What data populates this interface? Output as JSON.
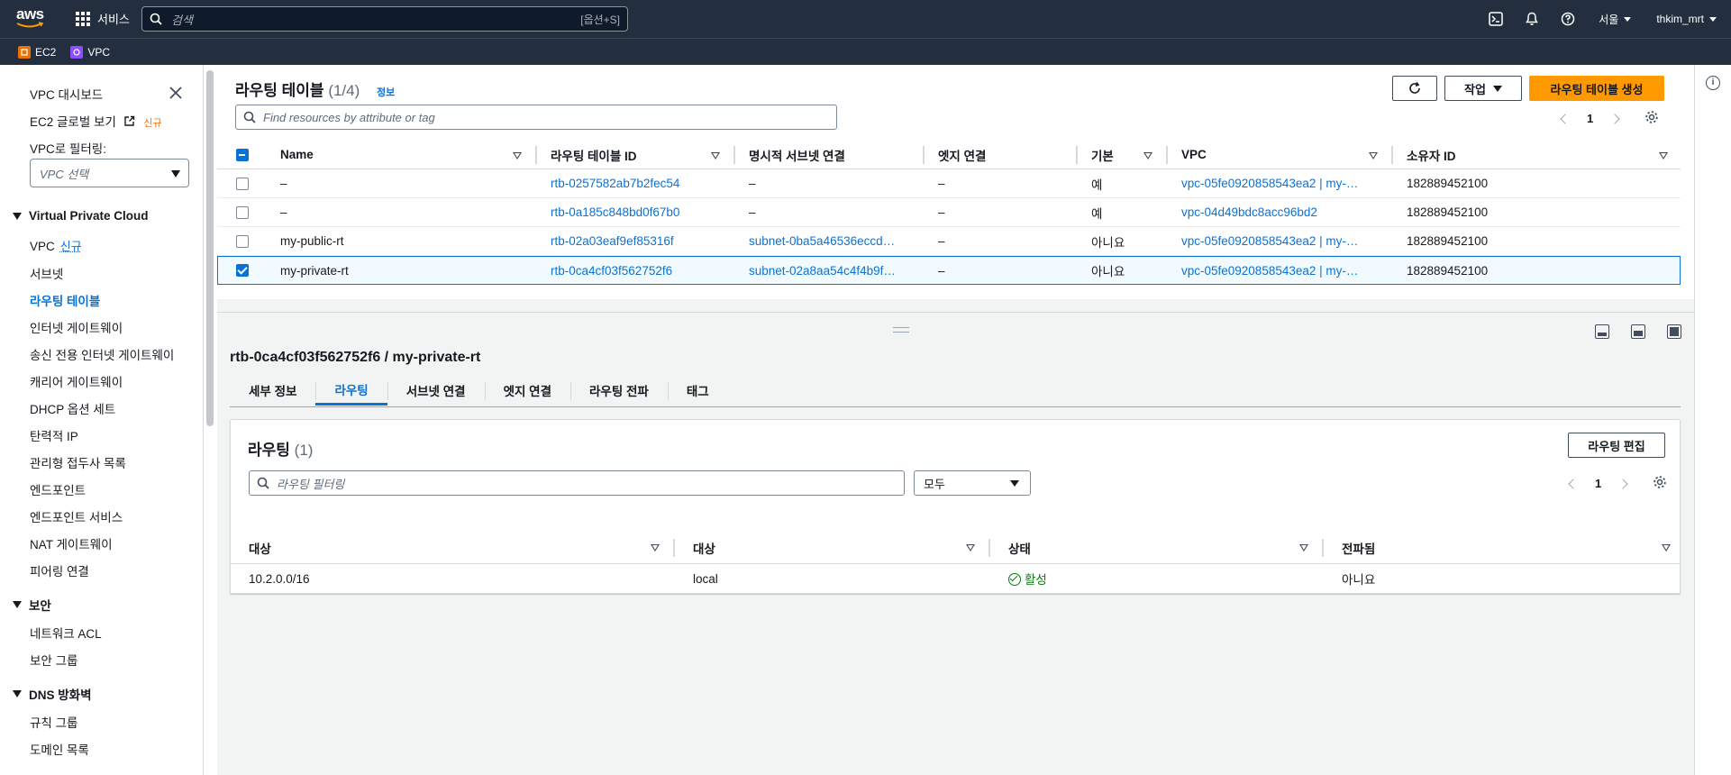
{
  "topnav": {
    "logo": "aws",
    "services_label": "서비스",
    "search_placeholder": "검색",
    "search_shortcut": "[옵션+S]",
    "region": "서울",
    "user": "thkim_mrt"
  },
  "favorites": [
    {
      "label": "EC2",
      "color": "#ed7100"
    },
    {
      "label": "VPC",
      "color": "#8c4fff"
    }
  ],
  "sidebar": {
    "dashboard": "VPC 대시보드",
    "ec2_global": "EC2 글로벌 보기",
    "new_badge": "신규",
    "filter_label": "VPC로 필터링:",
    "filter_placeholder": "VPC 선택",
    "section_vpc": "Virtual Private Cloud",
    "items": [
      "VPC",
      "서브넷",
      "라우팅 테이블",
      "인터넷 게이트웨이",
      "송신 전용 인터넷 게이트웨이",
      "캐리어 게이트웨이",
      "DHCP 옵션 세트",
      "탄력적 IP",
      "관리형 접두사 목록",
      "엔드포인트",
      "엔드포인트 서비스",
      "NAT 게이트웨이",
      "피어링 연결"
    ],
    "section_security": "보안",
    "security_items": [
      "네트워크 ACL",
      "보안 그룹"
    ],
    "section_dns": "DNS 방화벽",
    "dns_items": [
      "규칙 그룹",
      "도메인 목록"
    ]
  },
  "route_tables": {
    "title": "라우팅 테이블",
    "count": "(1/4)",
    "info": "정보",
    "actions_label": "작업",
    "create_label": "라우팅 테이블 생성",
    "filter_placeholder": "Find resources by attribute or tag",
    "page": "1",
    "columns": [
      "Name",
      "라우팅 테이블 ID",
      "명시적 서브넷 연결",
      "엣지 연결",
      "기본",
      "VPC",
      "소유자 ID"
    ],
    "rows": [
      {
        "name": "–",
        "id": "rtb-0257582ab7b2fec54",
        "subnet": "–",
        "edge": "–",
        "main": "예",
        "vpc": "vpc-05fe0920858543ea2 | my-…",
        "owner": "182889452100",
        "selected": false
      },
      {
        "name": "–",
        "id": "rtb-0a185c848bd0f67b0",
        "subnet": "–",
        "edge": "–",
        "main": "예",
        "vpc": "vpc-04d49bdc8acc96bd2",
        "owner": "182889452100",
        "selected": false
      },
      {
        "name": "my-public-rt",
        "id": "rtb-02a03eaf9ef85316f",
        "subnet": "subnet-0ba5a46536eccd…",
        "edge": "–",
        "main": "아니요",
        "vpc": "vpc-05fe0920858543ea2 | my-…",
        "owner": "182889452100",
        "selected": false
      },
      {
        "name": "my-private-rt",
        "id": "rtb-0ca4cf03f562752f6",
        "subnet": "subnet-02a8aa54c4f4b9f…",
        "edge": "–",
        "main": "아니요",
        "vpc": "vpc-05fe0920858543ea2 | my-…",
        "owner": "182889452100",
        "selected": true
      }
    ]
  },
  "detail": {
    "title": "rtb-0ca4cf03f562752f6 / my-private-rt",
    "tabs": [
      "세부 정보",
      "라우팅",
      "서브넷 연결",
      "엣지 연결",
      "라우팅 전파",
      "태그"
    ],
    "active_tab": "라우팅",
    "routes": {
      "title": "라우팅",
      "count": "(1)",
      "edit_label": "라우팅 편집",
      "filter_placeholder": "라우팅 필터링",
      "select_value": "모두",
      "page": "1",
      "columns": [
        "대상",
        "대상",
        "상태",
        "전파됨"
      ],
      "rows": [
        {
          "destination": "10.2.0.0/16",
          "target": "local",
          "status": "활성",
          "propagated": "아니요"
        }
      ]
    }
  }
}
